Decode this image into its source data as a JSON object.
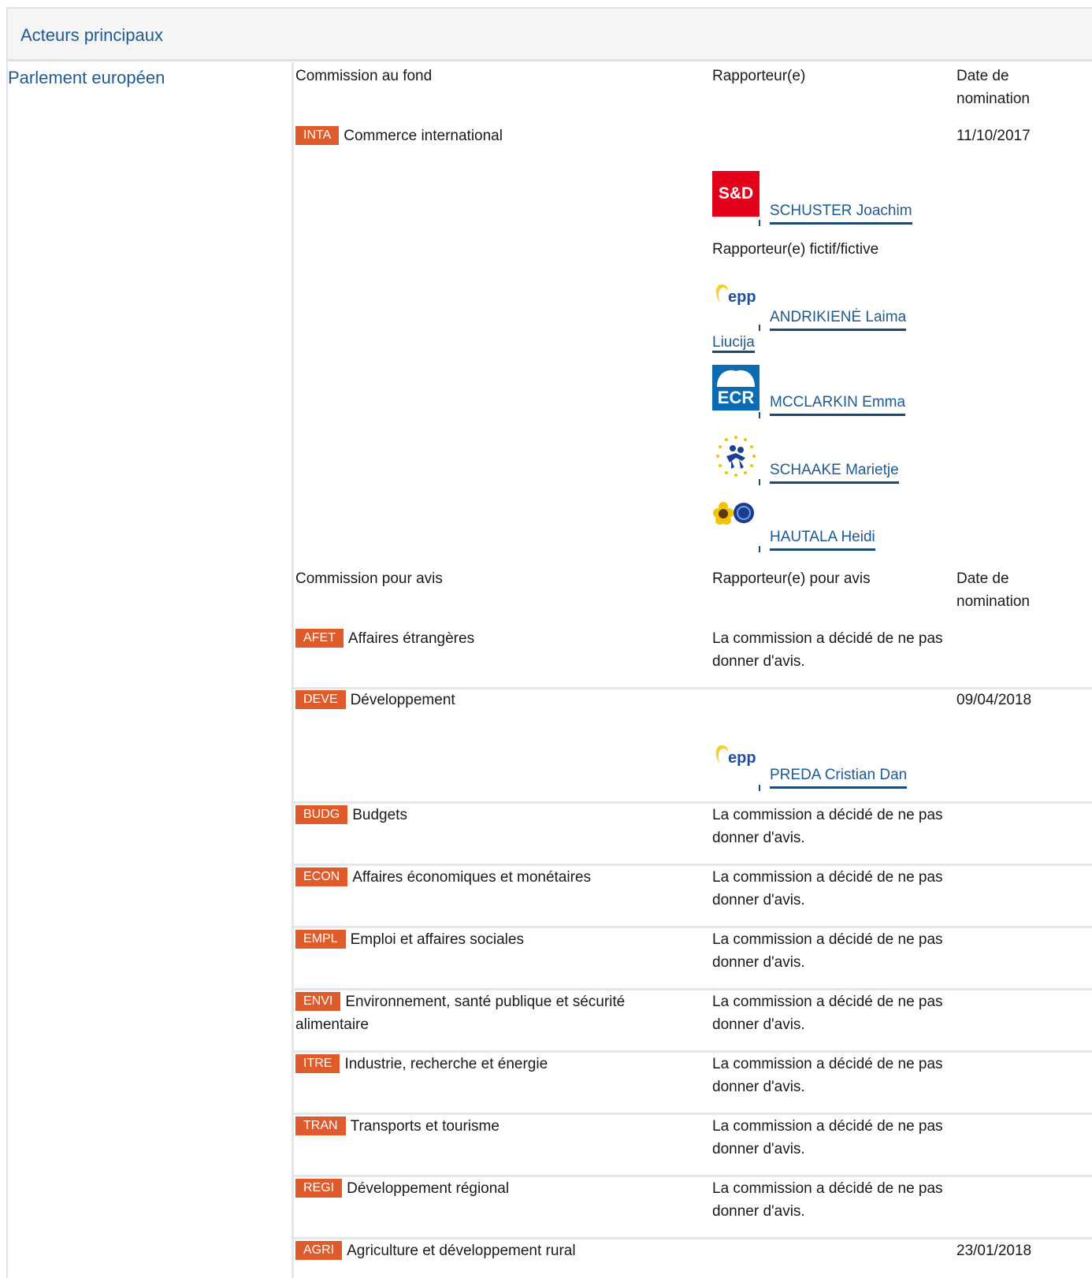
{
  "section": {
    "title": "Acteurs principaux"
  },
  "institution": "Parlement européen",
  "lead": {
    "header_committee": "Commission au fond",
    "header_rapporteur": "Rapporteur(e)",
    "header_date": "Date de nomination",
    "committee": {
      "code": "INTA",
      "name": "Commerce international",
      "date": "11/10/2017"
    },
    "rapporteur": {
      "group_logo": "S&D",
      "name": "SCHUSTER Joachim"
    },
    "shadow_label": "Rapporteur(e) fictif/fictive",
    "shadows": [
      {
        "group_logo": "epp",
        "name": "ANDRIKIENĖ Laima Liucija"
      },
      {
        "group_logo": "ECR",
        "name": "MCCLARKIN Emma"
      },
      {
        "group_logo": "renew-stars-icon",
        "name": "SCHAAKE Marietje"
      },
      {
        "group_logo": "greens-efa-icon",
        "name": "HAUTALA Heidi"
      }
    ]
  },
  "opinions": {
    "header_committee": "Commission pour avis",
    "header_rapporteur": "Rapporteur(e) pour avis",
    "header_date": "Date de nomination",
    "no_opinion_text": "La commission a décidé de ne pas donner d'avis.",
    "rows": [
      {
        "code": "AFET",
        "name": "Affaires étrangères",
        "notice": "La commission a décidé de ne pas donner d'avis."
      },
      {
        "code": "DEVE",
        "name": "Développement",
        "date": "09/04/2018",
        "rapporteur": {
          "group_logo": "epp",
          "name": "PREDA Cristian Dan"
        }
      },
      {
        "code": "BUDG",
        "name": "Budgets",
        "notice": "La commission a décidé de ne pas donner d'avis."
      },
      {
        "code": "ECON",
        "name": "Affaires économiques et monétaires",
        "notice": "La commission a décidé de ne pas donner d'avis."
      },
      {
        "code": "EMPL",
        "name": "Emploi et affaires sociales",
        "notice": "La commission a décidé de ne pas donner d'avis."
      },
      {
        "code": "ENVI",
        "name": "Environnement, santé publique et sécurité alimentaire",
        "notice": "La commission a décidé de ne pas donner d'avis."
      },
      {
        "code": "ITRE",
        "name": "Industrie, recherche et énergie",
        "notice": "La commission a décidé de ne pas donner d'avis."
      },
      {
        "code": "TRAN",
        "name": "Transports et tourisme",
        "notice": "La commission a décidé de ne pas donner d'avis."
      },
      {
        "code": "REGI",
        "name": "Développement régional",
        "notice": "La commission a décidé de ne pas donner d'avis."
      },
      {
        "code": "AGRI",
        "name": "Agriculture et développement rural",
        "date": "23/01/2018"
      }
    ]
  },
  "colors": {
    "badge": "#e05b2b",
    "link": "#1e5a96",
    "header_bg": "#f5f5f5"
  }
}
